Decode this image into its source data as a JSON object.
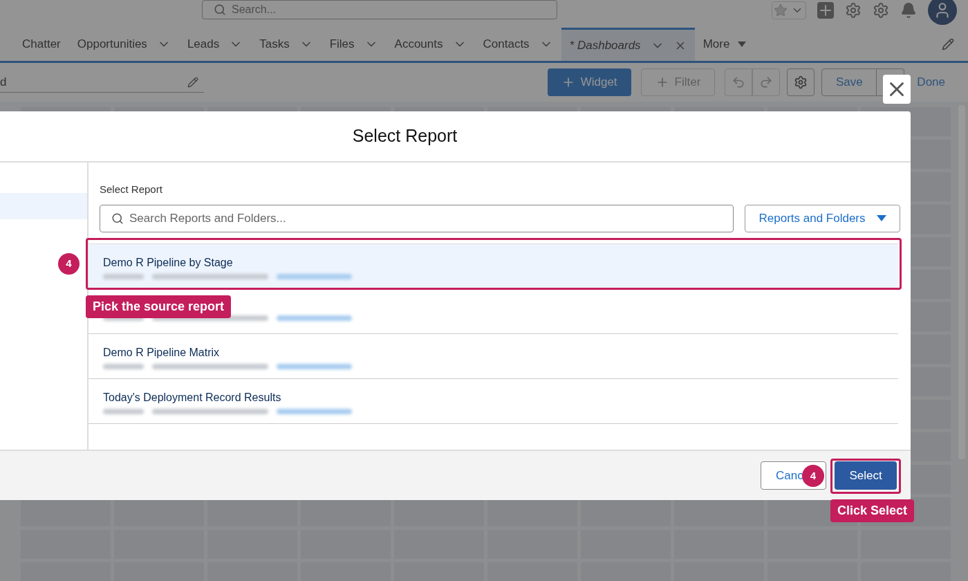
{
  "header": {
    "search_placeholder": "Search..."
  },
  "nav_tabs": [
    {
      "label": "Chatter",
      "selected": false,
      "has_menu": false
    },
    {
      "label": "Opportunities",
      "selected": false,
      "has_menu": true
    },
    {
      "label": "Leads",
      "selected": false,
      "has_menu": true
    },
    {
      "label": "Tasks",
      "selected": false,
      "has_menu": true
    },
    {
      "label": "Files",
      "selected": false,
      "has_menu": true
    },
    {
      "label": "Accounts",
      "selected": false,
      "has_menu": true
    },
    {
      "label": "Contacts",
      "selected": false,
      "has_menu": true
    },
    {
      "label": "* Dashboards",
      "selected": true,
      "has_menu": true
    }
  ],
  "more_tab": "More",
  "toolbar": {
    "name_value": "d",
    "widget": "Widget",
    "filter": "Filter",
    "save": "Save",
    "done": "Done"
  },
  "modal": {
    "title": "Select Report",
    "field_label": "Select Report",
    "search_placeholder": "Search Reports and Folders...",
    "scope": "Reports and Folders",
    "folders": [
      {
        "selected": true
      }
    ],
    "reports": [
      {
        "title": "Demo R Pipeline by Stage",
        "selected": true
      },
      {
        "selected": false
      },
      {
        "title": "Demo R Pipeline Matrix",
        "selected": false
      },
      {
        "title": "Today's Deployment Record Results",
        "selected": false
      }
    ],
    "cancel": "Canc",
    "select": "Select"
  },
  "callouts": {
    "row_badge": "4",
    "row_label": "Pick the source report",
    "button_badge": "4",
    "button_label": "Click Select"
  }
}
